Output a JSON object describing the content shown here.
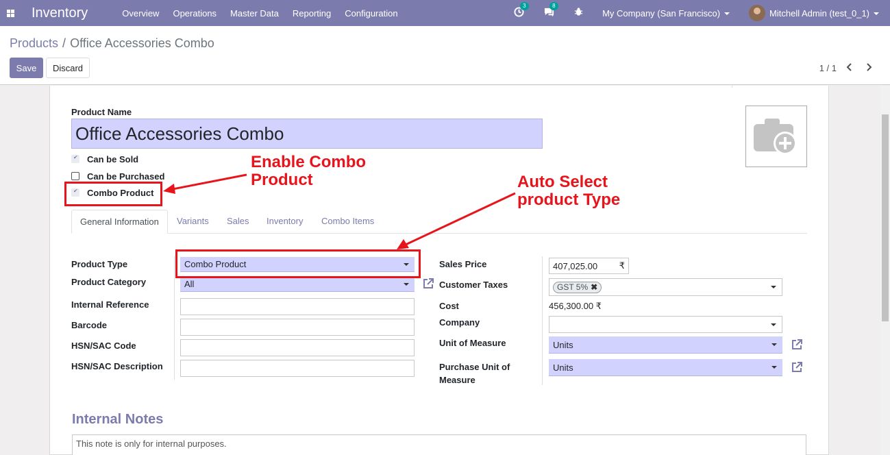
{
  "navbar": {
    "app_name": "Inventory",
    "menu": [
      "Overview",
      "Operations",
      "Master Data",
      "Reporting",
      "Configuration"
    ],
    "activity_count": "3",
    "messages_count": "8",
    "company": "My Company (San Francisco)",
    "user": "Mitchell Admin (test_0_1)"
  },
  "breadcrumb": {
    "parent": "Products",
    "separator": "/",
    "current": "Office Accessories Combo"
  },
  "buttons": {
    "save": "Save",
    "discard": "Discard"
  },
  "pager": {
    "value": "1 / 1",
    "prev_icon": "chevron-left-icon",
    "next_icon": "chevron-right-icon"
  },
  "product": {
    "name_label": "Product Name",
    "name": "Office Accessories Combo",
    "can_be_sold": {
      "label": "Can be Sold",
      "checked": true
    },
    "can_be_purchased": {
      "label": "Can be Purchased",
      "checked": false
    },
    "combo_product": {
      "label": "Combo Product",
      "checked": true
    }
  },
  "tabs": [
    "General Information",
    "Variants",
    "Sales",
    "Inventory",
    "Combo Items"
  ],
  "left_fields": {
    "product_type": {
      "label": "Product Type",
      "value": "Combo Product"
    },
    "product_category": {
      "label": "Product Category",
      "value": "All"
    },
    "internal_reference": {
      "label": "Internal Reference",
      "value": ""
    },
    "barcode": {
      "label": "Barcode",
      "value": ""
    },
    "hsn_code": {
      "label": "HSN/SAC Code",
      "value": ""
    },
    "hsn_description": {
      "label": "HSN/SAC Description",
      "value": ""
    }
  },
  "right_fields": {
    "sales_price": {
      "label": "Sales Price",
      "value": "407,025.00",
      "currency": "₹"
    },
    "customer_taxes": {
      "label": "Customer Taxes",
      "tag": "GST 5%"
    },
    "cost": {
      "label": "Cost",
      "value": "456,300.00 ₹"
    },
    "company": {
      "label": "Company",
      "value": ""
    },
    "uom": {
      "label": "Unit of Measure",
      "value": "Units"
    },
    "purchase_uom": {
      "label_line1": "Purchase Unit of",
      "label_line2": "Measure",
      "value": "Units"
    }
  },
  "notes": {
    "title": "Internal Notes",
    "placeholder": "This note is only for internal purposes."
  },
  "annotations": {
    "enable_combo_line1": "Enable Combo",
    "enable_combo_line2": "Product",
    "auto_select_line1": "Auto Select",
    "auto_select_line2": "product Type"
  },
  "colors": {
    "brand": "#7c7bad",
    "annotation": "#e8141b",
    "field_bg": "#d2d2ff",
    "badge": "#00a09d"
  }
}
